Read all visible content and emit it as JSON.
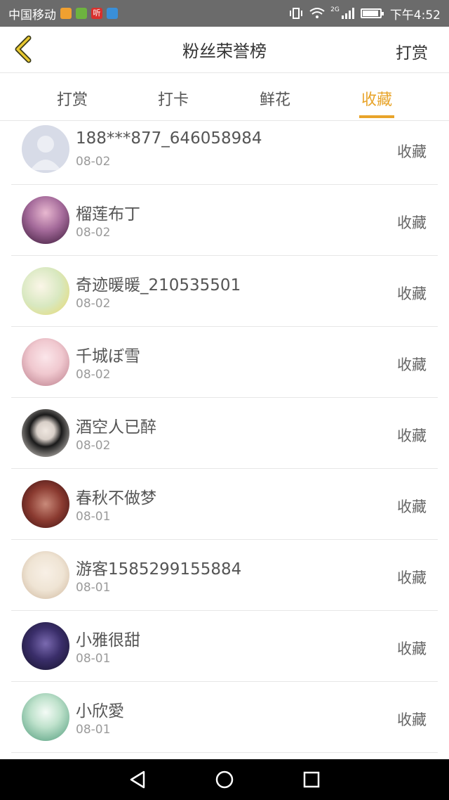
{
  "status_bar": {
    "carrier": "中国移动",
    "app_icons": [
      {
        "name": "app-orange-icon",
        "color": "#f0a030"
      },
      {
        "name": "app-green-icon",
        "color": "#6db33f"
      },
      {
        "name": "listen-app-icon",
        "label": "听",
        "color": "#d9302c"
      },
      {
        "name": "app-blue-icon",
        "color": "#3a8fd8"
      }
    ],
    "network": "2G",
    "time": "下午4:52"
  },
  "navbar": {
    "back_icon": "chevron-left-icon",
    "title": "粉丝荣誉榜",
    "action": "打赏"
  },
  "tabs": [
    {
      "label": "打赏",
      "active": false
    },
    {
      "label": "打卡",
      "active": false
    },
    {
      "label": "鲜花",
      "active": false
    },
    {
      "label": "收藏",
      "active": true
    }
  ],
  "colors": {
    "accent": "#e8a42a",
    "status_bar": "#6b6b6b",
    "divider": "#e6e6e6"
  },
  "fans": [
    {
      "name": "188***877_646058984",
      "date": "08-02",
      "type": "收藏",
      "avatar_colors": [
        "#c9cfe0",
        "#e4e7ef"
      ]
    },
    {
      "name": "榴莲布丁",
      "date": "08-02",
      "type": "收藏",
      "avatar_colors": [
        "#5a2a55",
        "#e8b8d0"
      ]
    },
    {
      "name": "奇迹暖暖_210535501",
      "date": "08-02",
      "type": "收藏",
      "avatar_colors": [
        "#d8e8c0",
        "#f3e9a8"
      ]
    },
    {
      "name": "千城ぼ雪",
      "date": "08-02",
      "type": "收藏",
      "avatar_colors": [
        "#f0c8cf",
        "#c98a9a"
      ]
    },
    {
      "name": "酒空人已醉",
      "date": "08-02",
      "type": "收藏",
      "avatar_colors": [
        "#1a1a1a",
        "#e8e2dc"
      ]
    },
    {
      "name": "春秋不做梦",
      "date": "08-01",
      "type": "收藏",
      "avatar_colors": [
        "#5a2020",
        "#c98a7a"
      ]
    },
    {
      "name": "游客1585299155884",
      "date": "08-01",
      "type": "收藏",
      "avatar_colors": [
        "#efe4d4",
        "#d8c0a8"
      ]
    },
    {
      "name": "小雅很甜",
      "date": "08-01",
      "type": "收藏",
      "avatar_colors": [
        "#1c1a3a",
        "#5a4a8a"
      ]
    },
    {
      "name": "小欣愛",
      "date": "08-01",
      "type": "收藏",
      "avatar_colors": [
        "#5aa88a",
        "#dff0e4"
      ]
    }
  ],
  "system_nav": {
    "back": "back-triangle-icon",
    "home": "home-circle-icon",
    "recents": "recents-square-icon"
  }
}
